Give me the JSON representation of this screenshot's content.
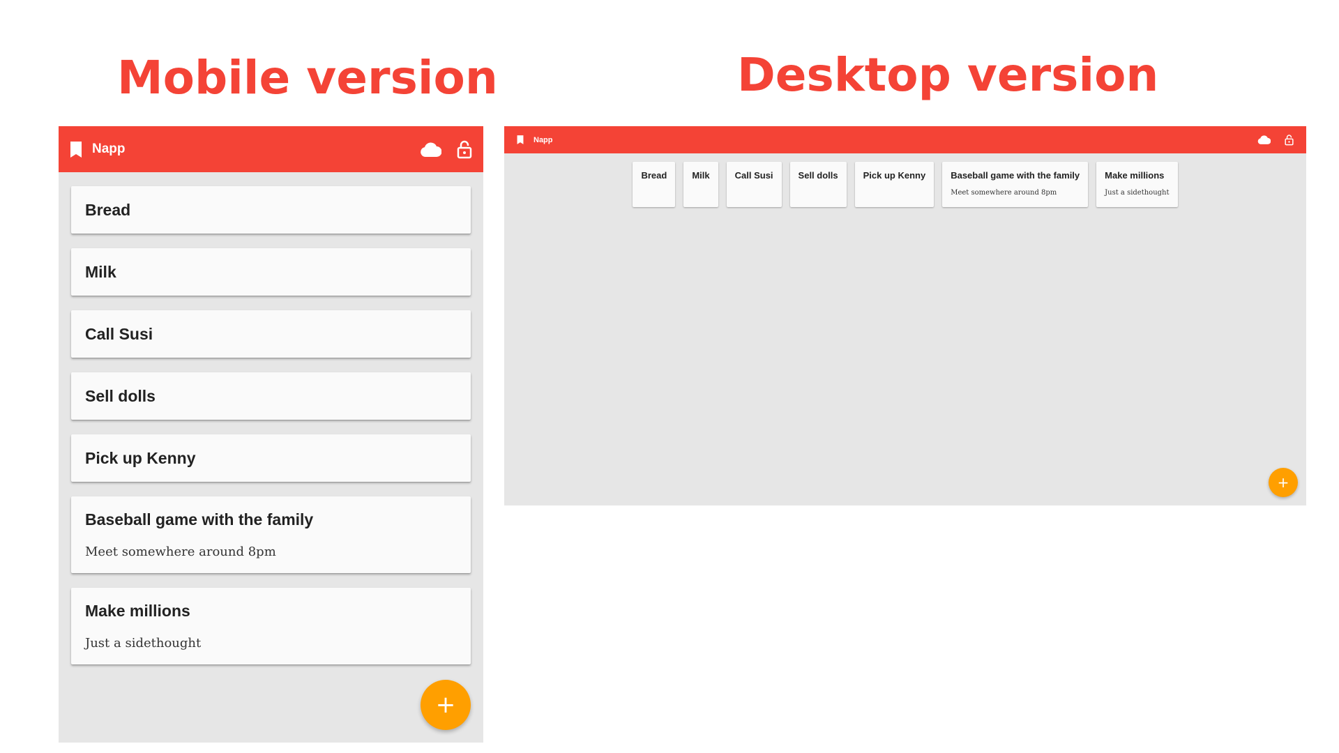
{
  "headings": {
    "mobile": "Mobile version",
    "desktop": "Desktop version"
  },
  "app": {
    "name": "Napp",
    "icons": {
      "brand": "bookmark-icon",
      "sync": "cloud-icon",
      "lock": "lock-open-icon",
      "fab": "plus-icon"
    },
    "fab_label": "+",
    "colors": {
      "app_bar": "#f44336",
      "background": "#e6e6e6",
      "card": "#fafafa",
      "fab": "#ff9f00",
      "heading": "#f44336"
    }
  },
  "notes": [
    {
      "title": "Bread",
      "body": ""
    },
    {
      "title": "Milk",
      "body": ""
    },
    {
      "title": "Call Susi",
      "body": ""
    },
    {
      "title": "Sell dolls",
      "body": ""
    },
    {
      "title": "Pick up Kenny",
      "body": ""
    },
    {
      "title": "Baseball game with the family",
      "body": "Meet somewhere around 8pm"
    },
    {
      "title": "Make millions",
      "body": "Just a sidethought"
    }
  ]
}
